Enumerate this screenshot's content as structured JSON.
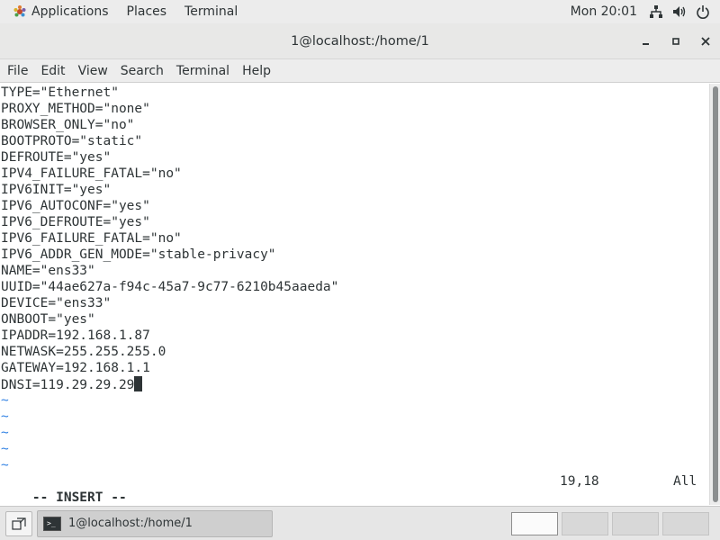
{
  "top_panel": {
    "applications_label": "Applications",
    "places_label": "Places",
    "terminal_label": "Terminal",
    "clock": "Mon 20:01",
    "icons": [
      "network-icon",
      "volume-icon",
      "power-icon"
    ]
  },
  "window": {
    "title": "1@localhost:/home/1",
    "controls": [
      "minimize-icon",
      "maximize-icon",
      "close-icon"
    ]
  },
  "menubar": {
    "items": [
      "File",
      "Edit",
      "View",
      "Search",
      "Terminal",
      "Help"
    ]
  },
  "editor": {
    "lines": [
      "TYPE=\"Ethernet\"",
      "PROXY_METHOD=\"none\"",
      "BROWSER_ONLY=\"no\"",
      "BOOTPROTO=\"static\"",
      "DEFROUTE=\"yes\"",
      "IPV4_FAILURE_FATAL=\"no\"",
      "IPV6INIT=\"yes\"",
      "IPV6_AUTOCONF=\"yes\"",
      "IPV6_DEFROUTE=\"yes\"",
      "IPV6_FAILURE_FATAL=\"no\"",
      "IPV6_ADDR_GEN_MODE=\"stable-privacy\"",
      "NAME=\"ens33\"",
      "UUID=\"44ae627a-f94c-45a7-9c77-6210b45aaeda\"",
      "DEVICE=\"ens33\"",
      "ONBOOT=\"yes\"",
      "IPADDR=192.168.1.87",
      "NETWASK=255.255.255.0",
      "GATEWAY=192.168.1.1",
      "DNSI=119.29.29.29"
    ],
    "tildes": [
      "~",
      "~",
      "~",
      "~",
      "~"
    ],
    "mode": "-- INSERT --",
    "position": "19,18",
    "percent": "All"
  },
  "taskbar": {
    "task_label": "1@localhost:/home/1",
    "task_icon_glyph": ">_"
  },
  "colors": {
    "tilde": "#3584e4",
    "text": "#2e3436",
    "panel": "#ececec"
  }
}
